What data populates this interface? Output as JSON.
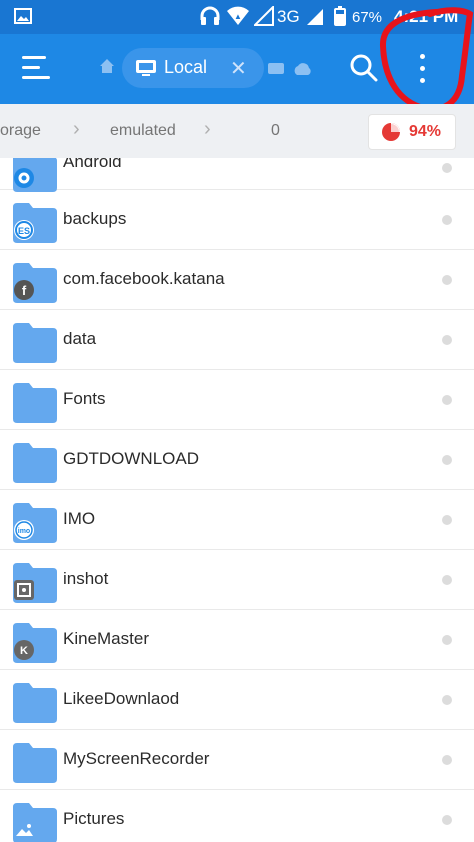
{
  "status_bar": {
    "network": "3G",
    "battery": "67%",
    "time": "4:21 PM"
  },
  "toolbar": {
    "active_tab_label": "Local"
  },
  "breadcrumb": {
    "items": [
      "orage",
      "emulated",
      "0"
    ],
    "storage_percent": "94%"
  },
  "files": [
    {
      "name": "Android",
      "badge": "gear"
    },
    {
      "name": "backups",
      "badge": "es"
    },
    {
      "name": "com.facebook.katana",
      "badge": "facebook"
    },
    {
      "name": "data",
      "badge": ""
    },
    {
      "name": "Fonts",
      "badge": ""
    },
    {
      "name": "GDTDOWNLOAD",
      "badge": ""
    },
    {
      "name": "IMO",
      "badge": "imo"
    },
    {
      "name": "inshot",
      "badge": "inshot"
    },
    {
      "name": "KineMaster",
      "badge": "kinemaster"
    },
    {
      "name": "LikeeDownlaod",
      "badge": ""
    },
    {
      "name": "MyScreenRecorder",
      "badge": ""
    },
    {
      "name": "Pictures",
      "badge": "image"
    }
  ],
  "colors": {
    "toolbar": "#1e88e5",
    "status_bar": "#1976d2",
    "folder": "#64a8ee",
    "annotation": "#e8131b",
    "storage": "#e53935"
  }
}
